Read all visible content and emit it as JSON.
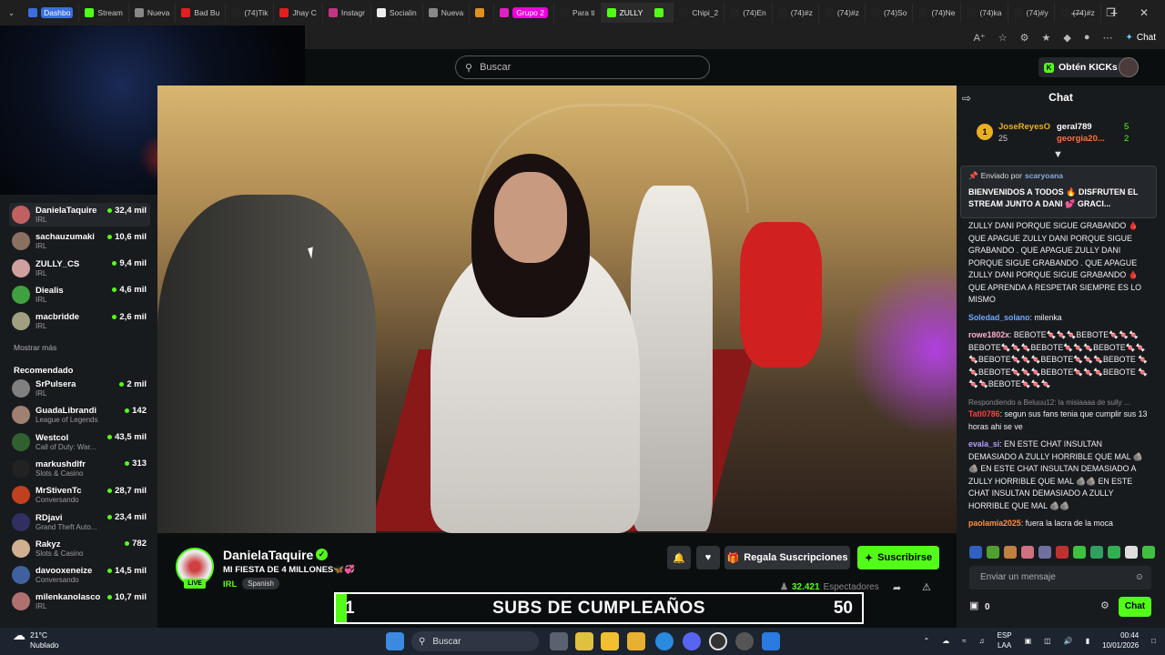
{
  "browser": {
    "tabs": [
      {
        "label": "Dashbo",
        "color": "#3b6fe0",
        "highlight": true
      },
      {
        "label": "Stream",
        "color": "#53fc18"
      },
      {
        "label": "Nueva",
        "color": "#888888"
      },
      {
        "label": "Bad Bu",
        "color": "#e02020"
      },
      {
        "label": "(74)Tik",
        "color": "#222222"
      },
      {
        "label": "Jhay C",
        "color": "#e02020"
      },
      {
        "label": "Instagr",
        "color": "#c13584"
      },
      {
        "label": "Socialin",
        "color": "#eeeeee"
      },
      {
        "label": "Nueva",
        "color": "#888888"
      },
      {
        "label": "",
        "color": "#e09020"
      },
      {
        "label": "Grupo 2",
        "color": "#e020c0",
        "pill": true
      },
      {
        "label": "Para ti",
        "color": "#222222"
      },
      {
        "label": "ZULLY",
        "color": "#53fc18",
        "active": true
      },
      {
        "label": "",
        "color": "#53fc18",
        "active": true
      },
      {
        "label": "Chipi_2",
        "color": "#222222"
      },
      {
        "label": "(74)En",
        "color": "#222222"
      },
      {
        "label": "(74)#z",
        "color": "#222222"
      },
      {
        "label": "(74)#z",
        "color": "#222222"
      },
      {
        "label": "(74)So",
        "color": "#222222"
      },
      {
        "label": "(74)Ne",
        "color": "#222222"
      },
      {
        "label": "(74)ka",
        "color": "#222222"
      },
      {
        "label": "(74)#y",
        "color": "#222222"
      },
      {
        "label": "(74)#z",
        "color": "#222222"
      }
    ],
    "new_tab": "+",
    "chat_button": "Chat"
  },
  "header": {
    "search_placeholder": "Buscar",
    "kicks_button": "Obtén KICKs"
  },
  "sidebar": {
    "following": [
      {
        "name": "DanielaTaquire",
        "category": "IRL",
        "viewers": "32,4 mil",
        "active": true,
        "avatar": "#c06060"
      },
      {
        "name": "sachauzumaki",
        "category": "IRL",
        "viewers": "10,6 mil",
        "avatar": "#8a7060"
      },
      {
        "name": "ZULLY_CS",
        "category": "IRL",
        "viewers": "9,4 mil",
        "avatar": "#d0a0a0"
      },
      {
        "name": "Diealis",
        "category": "IRL",
        "viewers": "4,6 mil",
        "avatar": "#40a040"
      },
      {
        "name": "macbridde",
        "category": "IRL",
        "viewers": "2,6 mil",
        "avatar": "#a0a080"
      }
    ],
    "show_more": "Mostrar más",
    "recommended_title": "Recomendado",
    "recommended": [
      {
        "name": "SrPulsera",
        "category": "IRL",
        "viewers": "2 mil",
        "avatar": "#808080"
      },
      {
        "name": "GuadaLibrandi",
        "category": "League of Legends",
        "viewers": "142",
        "avatar": "#a08070"
      },
      {
        "name": "Westcol",
        "category": "Call of Duty: War...",
        "viewers": "43,5 mil",
        "avatar": "#306030"
      },
      {
        "name": "markushdlfr",
        "category": "Slots & Casino",
        "viewers": "313",
        "avatar": "#222222"
      },
      {
        "name": "MrStivenTc",
        "category": "Conversando",
        "viewers": "28,7 mil",
        "avatar": "#c04020"
      },
      {
        "name": "RDjavi",
        "category": "Grand Theft Auto...",
        "viewers": "23,4 mil",
        "avatar": "#303060"
      },
      {
        "name": "Rakyz",
        "category": "Slots & Casino",
        "viewers": "782",
        "avatar": "#d0b090"
      },
      {
        "name": "davooxeneize",
        "category": "Conversando",
        "viewers": "14,5 mil",
        "avatar": "#4060a0"
      },
      {
        "name": "milenkanolasco",
        "category": "IRL",
        "viewers": "10,7 mil",
        "avatar": "#b07070"
      }
    ]
  },
  "stream": {
    "streamer": "DanielaTaquire",
    "title": "MI FIESTA DE 4 MILLONES🦋💞",
    "category": "IRL",
    "language": "Spanish",
    "live_label": "LIVE",
    "gift_button": "Regala Suscripciones",
    "subscribe_button": "Suscribirse",
    "viewers": "32.421",
    "viewers_label": "Espectadores"
  },
  "subs_goal": {
    "current": "1",
    "label": "SUBS DE CUMPLEAÑOS",
    "goal": "50",
    "progress": 0.02
  },
  "chat": {
    "title": "Chat",
    "top_gifters": [
      {
        "rank": "1",
        "name": "JoseReyesO",
        "count": "25"
      },
      {
        "name": "geral789",
        "count": "5"
      },
      {
        "name": "georgia20...",
        "count": "2"
      }
    ],
    "pinned": {
      "sender_prefix": "Enviado por",
      "sender": "scaryoana",
      "body": "BIENVENIDOS A TODOS 🔥 DISFRUTEN EL STREAM JUNTO A DANI 💕 GRACI..."
    },
    "messages": [
      {
        "user": "",
        "color": "#ffffff",
        "text": "ZULLY DANI PORQUE SIGUE GRABANDO 🩸 QUE APAGUE ZULLY DANI PORQUE SIGUE GRABANDO . QUE APAGUE ZULLY DANI PORQUE SIGUE GRABANDO . QUE APAGUE ZULLY DANI PORQUE SIGUE GRABANDO 🩸 QUE APRENDA A RESPETAR SIEMPRE ES LO MISMO"
      },
      {
        "user": "Soledad_solano",
        "color": "#6fa8ff",
        "text": "milenka"
      },
      {
        "user": "rowe1802x",
        "color": "#ffb0d0",
        "text": "BEBOTE🍬🍬🍬BEBOTE🍬🍬🍬 BEBOTE🍬🍬🍬BEBOTE🍬🍬🍬BEBOTE🍬🍬 🍬BEBOTE🍬🍬🍬BEBOTE🍬🍬🍬BEBOTE 🍬🍬BEBOTE🍬🍬🍬BEBOTE🍬🍬🍬BEBOTE 🍬🍬🍬BEBOTE🍬🍬🍬"
      },
      {
        "reply": "Respondiendo a Beluuu12: la misiaaaa de sully ...",
        "user": "Tati0786",
        "color": "#ff4040",
        "text": "segun sus fans tenia que cumplir sus 13 horas ahi se ve"
      },
      {
        "user": "evala_si",
        "color": "#b0a0ff",
        "text": "EN ESTE CHAT INSULTAN DEMASIADO A ZULLY HORRIBLE QUE MAL 🪨🪨 EN ESTE CHAT INSULTAN DEMASIADO A ZULLY HORRIBLE QUE MAL 🪨🪨 EN ESTE CHAT INSULTAN DEMASIADO A ZULLY HORRIBLE QUE MAL 🪨🪨"
      },
      {
        "user": "paolamia2025",
        "color": "#ff9040",
        "text": "fuera la lacra de la moca"
      }
    ],
    "input_placeholder": "Enviar un mensaje",
    "kicks_count": "0",
    "send_button": "Chat"
  },
  "taskbar": {
    "weather_temp": "21°C",
    "weather_desc": "Nublado",
    "search_placeholder": "Buscar",
    "lang_code": "ESP",
    "lang_region": "LAA",
    "time": "00:44",
    "date": "10/01/2026"
  }
}
